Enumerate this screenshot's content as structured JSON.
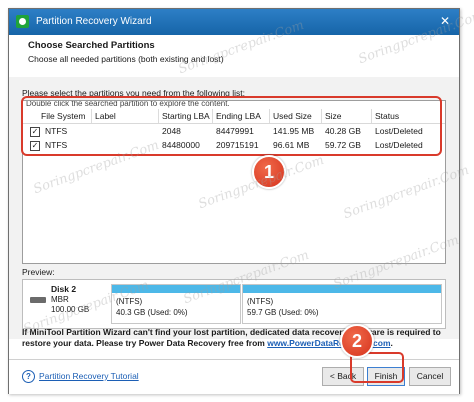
{
  "window": {
    "title": "Partition Recovery Wizard",
    "close_glyph": "✕"
  },
  "header": {
    "title": "Choose Searched Partitions",
    "subtitle": "Choose all needed partitions (both existing and lost)"
  },
  "instruction": "Please select the partitions you need from the following list:",
  "list_hint": "Double click the searched partition to explore the content.",
  "table": {
    "columns": [
      "File System",
      "Label",
      "Starting LBA",
      "Ending LBA",
      "Used Size",
      "Size",
      "Status"
    ],
    "rows": [
      {
        "checked": true,
        "file_system": "NTFS",
        "label": "",
        "starting_lba": "2048",
        "ending_lba": "84479991",
        "used_size": "141.95 MB",
        "size": "40.28 GB",
        "status": "Lost/Deleted"
      },
      {
        "checked": true,
        "file_system": "NTFS",
        "label": "",
        "starting_lba": "84480000",
        "ending_lba": "209715191",
        "used_size": "96.61 MB",
        "size": "59.72 GB",
        "status": "Lost/Deleted"
      }
    ]
  },
  "badges": {
    "one": "1",
    "two": "2"
  },
  "preview": {
    "label": "Preview:",
    "disk": {
      "name": "Disk 2",
      "type": "MBR",
      "size": "100.00 GB"
    },
    "partitions": [
      {
        "fs": "(NTFS)",
        "info": "40.3 GB (Used: 0%)"
      },
      {
        "fs": "(NTFS)",
        "info": "59.7 GB (Used: 0%)"
      }
    ]
  },
  "footnote": {
    "text": "If MiniTool Partition Wizard can't find your lost partition, dedicated data recovery software is required to restore your data. Please try Power Data Recovery free from",
    "link": "www.PowerDataRecovery.com",
    "after_link": "."
  },
  "footer": {
    "help_icon": "?",
    "tutorial_link": "Partition Recovery Tutorial",
    "back_label": "< Back",
    "finish_label": "Finish",
    "cancel_label": "Cancel"
  },
  "watermarks": [
    "Soringpcrepair.Com",
    "Soringpcrepair.Com",
    "Soringpcrepair.Com",
    "Soringpcrepair.Com",
    "Soringpcrepair.Com",
    "Soringpcrepair.Com",
    "Soringpcrepair.Com",
    "Soringpcrepair.Com"
  ],
  "colors": {
    "titlebar": "#1b6db4",
    "highlight": "#d93a2b",
    "partition_bar": "#4db8e8",
    "link": "#1c5fb5"
  }
}
